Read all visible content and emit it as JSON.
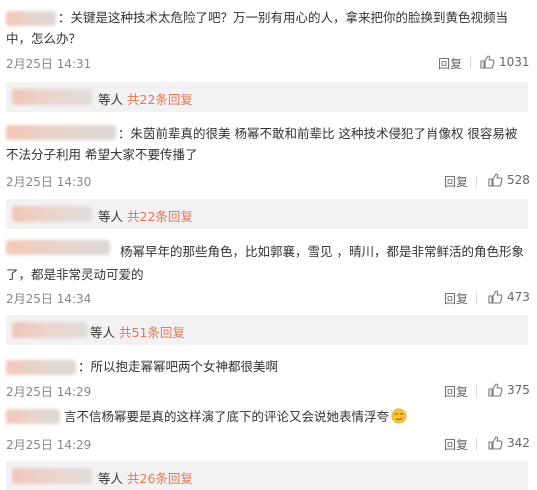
{
  "comments": [
    {
      "text": "：关键是这种技术太危险了吧？万一别有用心的人，拿来把你的脸换到黄色视频当中，怎么办？",
      "time": "2月25日 14:31",
      "reply_label": "回复",
      "likes": "1031",
      "sub": {
        "prefix": "等人",
        "link": "共22条回复"
      }
    },
    {
      "text": "：朱茵前辈真的很美 杨幂不敢和前辈比 这种技术侵犯了肖像权 很容易被不法分子利用 希望大家不要传播了",
      "time": "2月25日 14:30",
      "reply_label": "回复",
      "likes": "528",
      "sub": {
        "prefix": "等人",
        "link": "共22条回复"
      }
    },
    {
      "text": "杨幂早年的那些角色，比如郭襄，雪见 ，晴川，都是非常鲜活的角色形象了，都是非常灵动可爱的",
      "time": "2月25日 14:34",
      "reply_label": "回复",
      "likes": "473",
      "sub": {
        "prefix": "等人",
        "link": "共51条回复"
      }
    },
    {
      "text": "：所以抱走幂幂吧两个女神都很美啊",
      "time": "2月25日 14:29",
      "reply_label": "回复",
      "likes": "375"
    },
    {
      "text": "言不信杨幂要是真的这样演了底下的评论又会说她表情浮夸",
      "time": "2月25日 14:29",
      "reply_label": "回复",
      "likes": "342",
      "sub": {
        "prefix": "等人",
        "link": "共26条回复"
      }
    }
  ],
  "colors": {
    "link": "#eb7350",
    "subbox": "#f2f2f5",
    "meta": "#888888"
  },
  "icons": {
    "like": "thumbs-up-icon",
    "emoji": "smirk-emoji-icon"
  }
}
